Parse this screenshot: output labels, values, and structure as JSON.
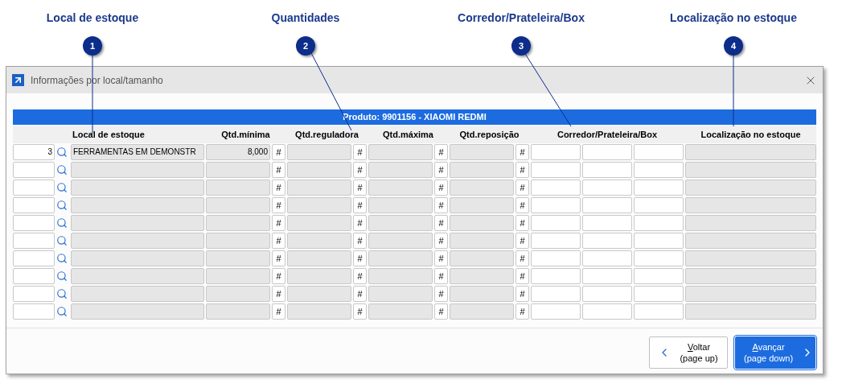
{
  "callouts": [
    {
      "number": "1",
      "label": "Local de estoque"
    },
    {
      "number": "2",
      "label": "Quantidades"
    },
    {
      "number": "3",
      "label": "Corredor/Prateleira/Box"
    },
    {
      "number": "4",
      "label": "Localização no estoque"
    }
  ],
  "window": {
    "title": "Informações por local/tamanho"
  },
  "product_bar": "Produto: 9901156 - XIAOMI REDMI",
  "columns": [
    "Local de estoque",
    "Qtd.mínima",
    "Qtd.reguladora",
    "Qtd.máxima",
    "Qtd.reposição",
    "Corredor/Prateleira/Box",
    "Localização no estoque"
  ],
  "hash_label": "#",
  "rows": [
    {
      "code": "3",
      "local": "FERRAMENTAS EM DEMONSTR",
      "min": "8,000"
    },
    {},
    {},
    {},
    {},
    {},
    {},
    {},
    {},
    {}
  ],
  "buttons": [
    {
      "kind": "back",
      "label": "Voltar",
      "hint": "(page up)",
      "primary": false
    },
    {
      "kind": "next",
      "label": "Avançar",
      "hint": "(page down)",
      "primary": true
    }
  ]
}
